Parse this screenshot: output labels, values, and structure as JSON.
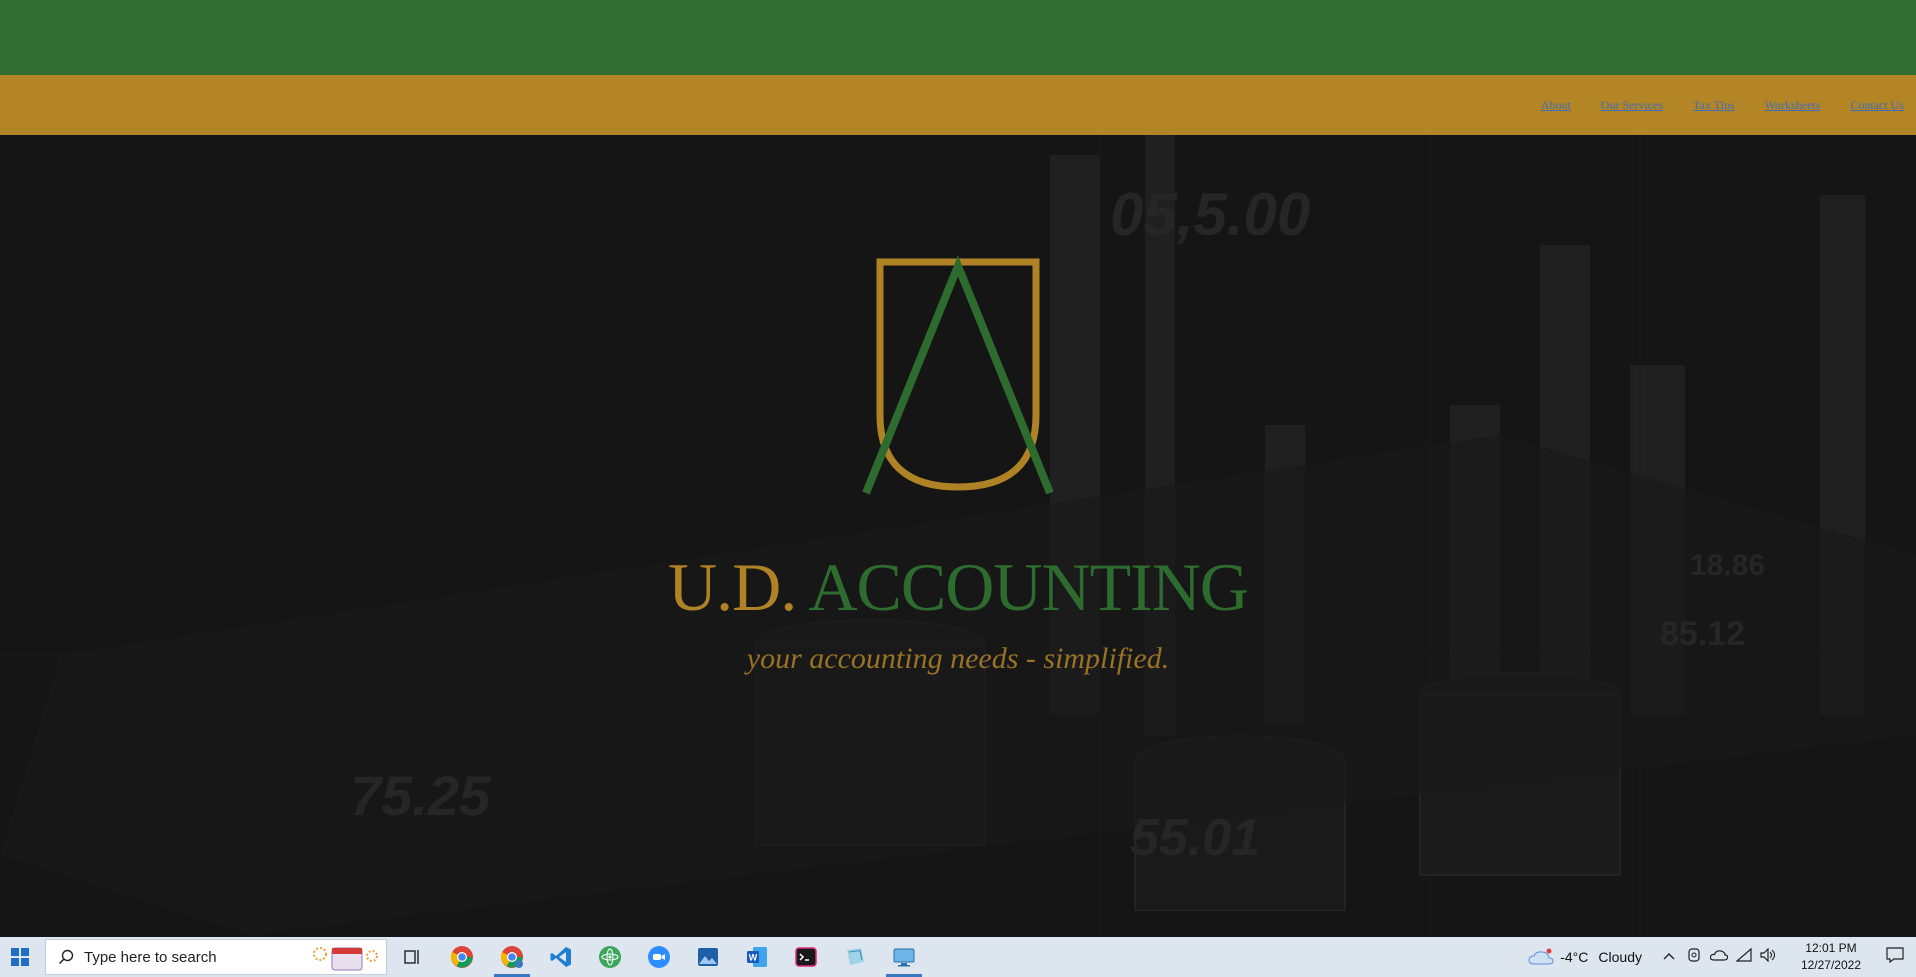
{
  "nav": {
    "links": [
      "About",
      "Our Services",
      "Tax Tips",
      "Worksheets",
      "Contact Us"
    ]
  },
  "brand": {
    "initials": "U.D.",
    "name": "ACCOUNTING",
    "tagline": "your accounting needs - simplified."
  },
  "background_figures": [
    "05,5.00",
    "55.01",
    "75.25",
    "85.12",
    "18.86"
  ],
  "colors": {
    "green": "#316e31",
    "gold": "#b48525",
    "dark": "#191919",
    "link": "#3f6eb8"
  },
  "taskbar": {
    "search_placeholder": "Type here to search",
    "weather_temp": "-4°C",
    "weather_desc": "Cloudy",
    "time": "12:01 PM",
    "date": "12/27/2022",
    "apps": [
      "task-view",
      "chrome",
      "chrome-profile",
      "vscode",
      "atom",
      "zoom",
      "photos",
      "word",
      "terminal",
      "notepad",
      "remote-desktop"
    ]
  }
}
